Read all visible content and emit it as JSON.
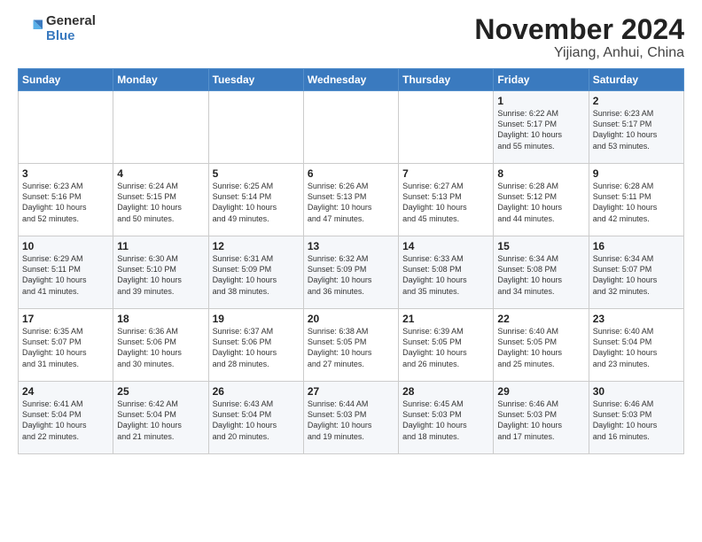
{
  "logo": {
    "general": "General",
    "blue": "Blue"
  },
  "title": "November 2024",
  "location": "Yijiang, Anhui, China",
  "weekdays": [
    "Sunday",
    "Monday",
    "Tuesday",
    "Wednesday",
    "Thursday",
    "Friday",
    "Saturday"
  ],
  "weeks": [
    [
      {
        "day": "",
        "info": ""
      },
      {
        "day": "",
        "info": ""
      },
      {
        "day": "",
        "info": ""
      },
      {
        "day": "",
        "info": ""
      },
      {
        "day": "",
        "info": ""
      },
      {
        "day": "1",
        "info": "Sunrise: 6:22 AM\nSunset: 5:17 PM\nDaylight: 10 hours\nand 55 minutes."
      },
      {
        "day": "2",
        "info": "Sunrise: 6:23 AM\nSunset: 5:17 PM\nDaylight: 10 hours\nand 53 minutes."
      }
    ],
    [
      {
        "day": "3",
        "info": "Sunrise: 6:23 AM\nSunset: 5:16 PM\nDaylight: 10 hours\nand 52 minutes."
      },
      {
        "day": "4",
        "info": "Sunrise: 6:24 AM\nSunset: 5:15 PM\nDaylight: 10 hours\nand 50 minutes."
      },
      {
        "day": "5",
        "info": "Sunrise: 6:25 AM\nSunset: 5:14 PM\nDaylight: 10 hours\nand 49 minutes."
      },
      {
        "day": "6",
        "info": "Sunrise: 6:26 AM\nSunset: 5:13 PM\nDaylight: 10 hours\nand 47 minutes."
      },
      {
        "day": "7",
        "info": "Sunrise: 6:27 AM\nSunset: 5:13 PM\nDaylight: 10 hours\nand 45 minutes."
      },
      {
        "day": "8",
        "info": "Sunrise: 6:28 AM\nSunset: 5:12 PM\nDaylight: 10 hours\nand 44 minutes."
      },
      {
        "day": "9",
        "info": "Sunrise: 6:28 AM\nSunset: 5:11 PM\nDaylight: 10 hours\nand 42 minutes."
      }
    ],
    [
      {
        "day": "10",
        "info": "Sunrise: 6:29 AM\nSunset: 5:11 PM\nDaylight: 10 hours\nand 41 minutes."
      },
      {
        "day": "11",
        "info": "Sunrise: 6:30 AM\nSunset: 5:10 PM\nDaylight: 10 hours\nand 39 minutes."
      },
      {
        "day": "12",
        "info": "Sunrise: 6:31 AM\nSunset: 5:09 PM\nDaylight: 10 hours\nand 38 minutes."
      },
      {
        "day": "13",
        "info": "Sunrise: 6:32 AM\nSunset: 5:09 PM\nDaylight: 10 hours\nand 36 minutes."
      },
      {
        "day": "14",
        "info": "Sunrise: 6:33 AM\nSunset: 5:08 PM\nDaylight: 10 hours\nand 35 minutes."
      },
      {
        "day": "15",
        "info": "Sunrise: 6:34 AM\nSunset: 5:08 PM\nDaylight: 10 hours\nand 34 minutes."
      },
      {
        "day": "16",
        "info": "Sunrise: 6:34 AM\nSunset: 5:07 PM\nDaylight: 10 hours\nand 32 minutes."
      }
    ],
    [
      {
        "day": "17",
        "info": "Sunrise: 6:35 AM\nSunset: 5:07 PM\nDaylight: 10 hours\nand 31 minutes."
      },
      {
        "day": "18",
        "info": "Sunrise: 6:36 AM\nSunset: 5:06 PM\nDaylight: 10 hours\nand 30 minutes."
      },
      {
        "day": "19",
        "info": "Sunrise: 6:37 AM\nSunset: 5:06 PM\nDaylight: 10 hours\nand 28 minutes."
      },
      {
        "day": "20",
        "info": "Sunrise: 6:38 AM\nSunset: 5:05 PM\nDaylight: 10 hours\nand 27 minutes."
      },
      {
        "day": "21",
        "info": "Sunrise: 6:39 AM\nSunset: 5:05 PM\nDaylight: 10 hours\nand 26 minutes."
      },
      {
        "day": "22",
        "info": "Sunrise: 6:40 AM\nSunset: 5:05 PM\nDaylight: 10 hours\nand 25 minutes."
      },
      {
        "day": "23",
        "info": "Sunrise: 6:40 AM\nSunset: 5:04 PM\nDaylight: 10 hours\nand 23 minutes."
      }
    ],
    [
      {
        "day": "24",
        "info": "Sunrise: 6:41 AM\nSunset: 5:04 PM\nDaylight: 10 hours\nand 22 minutes."
      },
      {
        "day": "25",
        "info": "Sunrise: 6:42 AM\nSunset: 5:04 PM\nDaylight: 10 hours\nand 21 minutes."
      },
      {
        "day": "26",
        "info": "Sunrise: 6:43 AM\nSunset: 5:04 PM\nDaylight: 10 hours\nand 20 minutes."
      },
      {
        "day": "27",
        "info": "Sunrise: 6:44 AM\nSunset: 5:03 PM\nDaylight: 10 hours\nand 19 minutes."
      },
      {
        "day": "28",
        "info": "Sunrise: 6:45 AM\nSunset: 5:03 PM\nDaylight: 10 hours\nand 18 minutes."
      },
      {
        "day": "29",
        "info": "Sunrise: 6:46 AM\nSunset: 5:03 PM\nDaylight: 10 hours\nand 17 minutes."
      },
      {
        "day": "30",
        "info": "Sunrise: 6:46 AM\nSunset: 5:03 PM\nDaylight: 10 hours\nand 16 minutes."
      }
    ]
  ]
}
